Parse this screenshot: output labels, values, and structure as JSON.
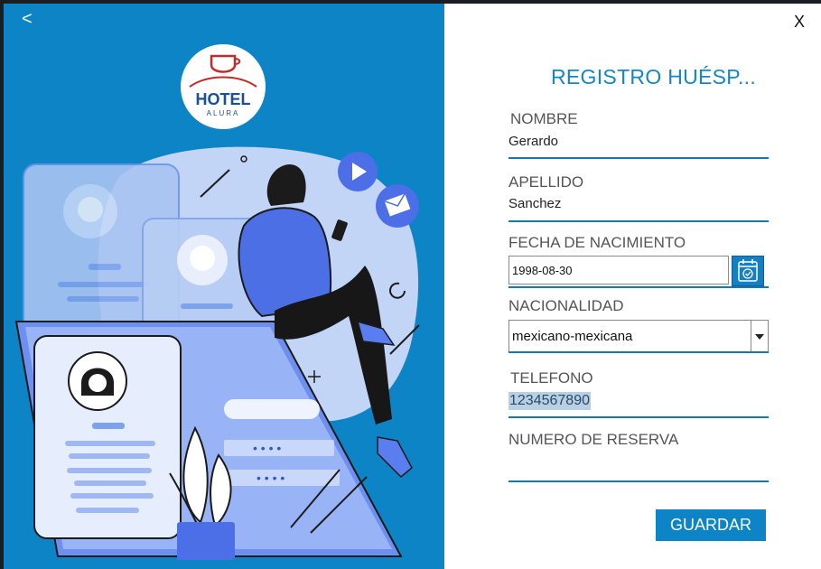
{
  "window": {
    "back_label": "<",
    "close_label": "X"
  },
  "logo": {
    "line1": "HOTEL",
    "line2": "ALURA"
  },
  "form": {
    "title": "REGISTRO HUÉSP...",
    "nombre_label": "NOMBRE",
    "nombre_value": "Gerardo",
    "apellido_label": "APELLIDO",
    "apellido_value": "Sanchez",
    "fecha_label": "FECHA DE NACIMIENTO",
    "fecha_value": "1998-08-30",
    "nacionalidad_label": "NACIONALIDAD",
    "nacionalidad_value": "mexicano-mexicana",
    "telefono_label": "TELEFONO",
    "telefono_value": "1234567890",
    "reserva_label": "NUMERO DE RESERVA",
    "reserva_value": "",
    "save_label": "GUARDAR"
  },
  "illustration": {
    "password_mask": "• • • •"
  },
  "colors": {
    "accent": "#0d84c6",
    "title": "#1486c6",
    "line": "#1477b8"
  }
}
